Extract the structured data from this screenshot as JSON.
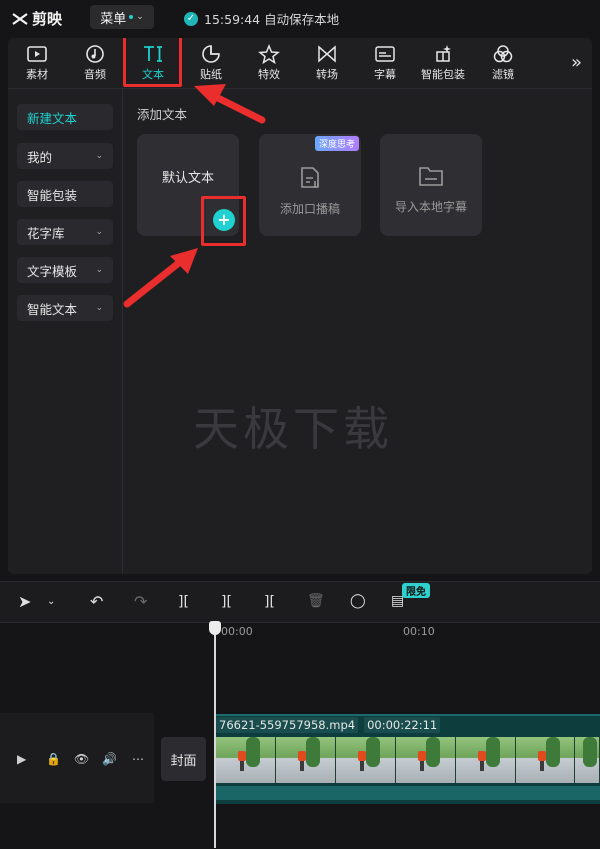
{
  "app": {
    "name": "剪映",
    "menu_label": "菜单",
    "save_status": "15:59:44 自动保存本地"
  },
  "toolbar": {
    "items": [
      {
        "label": "素材",
        "icon": "media-icon"
      },
      {
        "label": "音频",
        "icon": "audio-icon"
      },
      {
        "label": "文本",
        "icon": "text-icon",
        "active": true
      },
      {
        "label": "贴纸",
        "icon": "sticker-icon"
      },
      {
        "label": "特效",
        "icon": "effects-icon"
      },
      {
        "label": "转场",
        "icon": "transition-icon"
      },
      {
        "label": "字幕",
        "icon": "subtitle-icon"
      },
      {
        "label": "智能包装",
        "icon": "smart-pack-icon"
      },
      {
        "label": "滤镜",
        "icon": "filter-icon"
      }
    ],
    "more_icon": "double-chevron-right-icon"
  },
  "sidebar": {
    "items": [
      {
        "label": "新建文本",
        "active": true,
        "has_dropdown": false
      },
      {
        "label": "我的",
        "has_dropdown": true
      },
      {
        "label": "智能包装",
        "has_dropdown": false
      },
      {
        "label": "花字库",
        "has_dropdown": true
      },
      {
        "label": "文字模板",
        "has_dropdown": true
      },
      {
        "label": "智能文本",
        "has_dropdown": true
      }
    ]
  },
  "content": {
    "section_title": "添加文本",
    "cards": [
      {
        "label": "默认文本"
      },
      {
        "label": "添加口播稿",
        "badge": "深度思考"
      },
      {
        "label": "导入本地字幕"
      }
    ],
    "watermark": "天极下载"
  },
  "timeline": {
    "limited_badge": "限免",
    "ruler": [
      "00:00",
      "00:10"
    ],
    "cover_label": "封面",
    "clip_name": "76621-559757958.mp4",
    "clip_duration": "00:00:22:11"
  },
  "colors": {
    "accent": "#1fd1d0",
    "annotation": "#ea2d2d",
    "background": "#151517",
    "panel": "#1f1f22"
  }
}
